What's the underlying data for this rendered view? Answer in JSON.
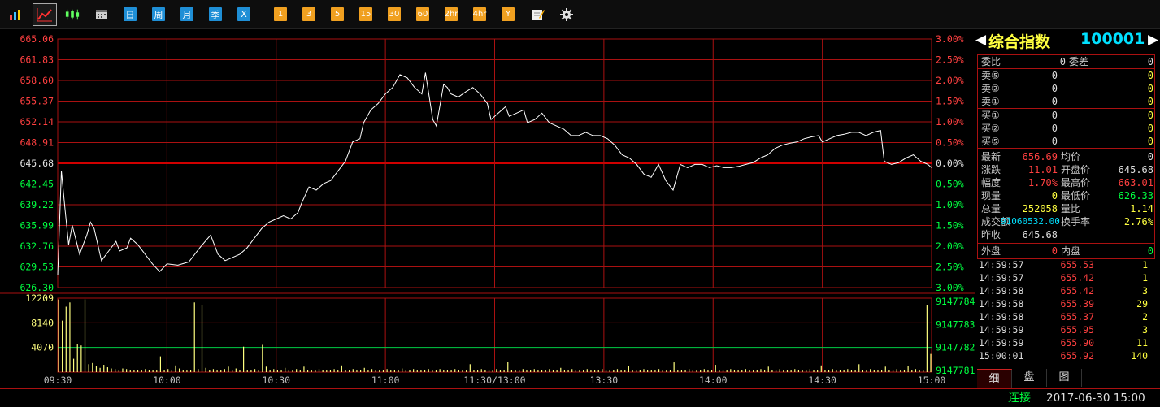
{
  "toolbar": {
    "icons": [
      "bar-chart-icon",
      "line-chart-icon",
      "candlestick-icon",
      "calendar-icon"
    ],
    "periods": [
      "日",
      "周",
      "月",
      "季",
      "X"
    ],
    "minutes": [
      "1",
      "3",
      "5",
      "15",
      "30",
      "60",
      "2hr",
      "4hr",
      "Y"
    ],
    "tools": [
      "edit-icon",
      "gear-icon"
    ]
  },
  "colors": {
    "up": "#ff4040",
    "down": "#00ff40",
    "grid": "#aa1111",
    "price_line": "#ffffff",
    "avg_line": "#ffff00",
    "volume": "#ffff80",
    "zero_line": "#c00000",
    "vol_ref": "#00cc44"
  },
  "chart_data": [
    {
      "type": "line",
      "title": "",
      "y_left_ticks": [
        "665.06",
        "661.83",
        "658.60",
        "655.37",
        "652.14",
        "648.91",
        "645.68",
        "642.45",
        "639.22",
        "635.99",
        "632.76",
        "629.53",
        "626.30"
      ],
      "y_right_ticks": [
        "3.00%",
        "2.50%",
        "2.00%",
        "1.50%",
        "1.00%",
        "0.50%",
        "0.00%",
        "0.50%",
        "1.00%",
        "1.50%",
        "2.00%",
        "2.50%",
        "3.00%"
      ],
      "ylim": [
        626.3,
        665.06
      ],
      "reference": 645.68,
      "x_ticks": [
        "09:30",
        "10:00",
        "10:30",
        "11:00",
        "11:30/13:00",
        "13:30",
        "14:00",
        "14:30",
        "15:00"
      ],
      "x_range": [
        0,
        240
      ],
      "series": [
        {
          "points": [
            [
              0,
              628.2
            ],
            [
              1,
              644.5
            ],
            [
              2,
              638.5
            ],
            [
              3,
              633.0
            ],
            [
              4,
              636.0
            ],
            [
              6,
              631.5
            ],
            [
              8,
              634.5
            ],
            [
              9,
              636.5
            ],
            [
              10,
              635.5
            ],
            [
              12,
              630.5
            ],
            [
              14,
              632.0
            ],
            [
              16,
              633.5
            ],
            [
              17,
              632.0
            ],
            [
              19,
              632.5
            ],
            [
              20,
              634.0
            ],
            [
              22,
              633.0
            ],
            [
              24,
              631.5
            ],
            [
              26,
              630.0
            ],
            [
              28,
              628.8
            ],
            [
              30,
              630.0
            ],
            [
              33,
              629.8
            ],
            [
              36,
              630.3
            ],
            [
              39,
              632.5
            ],
            [
              42,
              634.5
            ],
            [
              44,
              631.5
            ],
            [
              46,
              630.5
            ],
            [
              48,
              631.0
            ],
            [
              50,
              631.5
            ],
            [
              52,
              632.5
            ],
            [
              54,
              634.0
            ],
            [
              56,
              635.5
            ],
            [
              58,
              636.5
            ],
            [
              60,
              637.0
            ],
            [
              62,
              637.5
            ],
            [
              64,
              637.0
            ],
            [
              66,
              638.0
            ],
            [
              67,
              639.5
            ],
            [
              69,
              642.0
            ],
            [
              71,
              641.5
            ],
            [
              73,
              642.5
            ],
            [
              75,
              643.0
            ],
            [
              77,
              644.5
            ],
            [
              79,
              646.0
            ],
            [
              81,
              649.0
            ],
            [
              83,
              649.5
            ],
            [
              84,
              652.0
            ],
            [
              86,
              654.0
            ],
            [
              88,
              655.0
            ],
            [
              90,
              656.5
            ],
            [
              92,
              657.5
            ],
            [
              94,
              659.5
            ],
            [
              96,
              659.0
            ],
            [
              98,
              657.5
            ],
            [
              100,
              656.5
            ],
            [
              101,
              659.8
            ],
            [
              103,
              652.5
            ],
            [
              104,
              651.5
            ],
            [
              106,
              658.0
            ],
            [
              107,
              657.5
            ],
            [
              108,
              656.5
            ],
            [
              110,
              656.0
            ],
            [
              112,
              656.8
            ],
            [
              114,
              657.5
            ],
            [
              116,
              656.5
            ],
            [
              118,
              655.0
            ],
            [
              119,
              652.5
            ],
            [
              121,
              653.5
            ],
            [
              123,
              654.5
            ],
            [
              124,
              653.0
            ],
            [
              126,
              653.5
            ],
            [
              128,
              654.0
            ],
            [
              129,
              652.0
            ],
            [
              131,
              652.5
            ],
            [
              133,
              653.5
            ],
            [
              135,
              652.0
            ],
            [
              137,
              651.5
            ],
            [
              139,
              651.0
            ],
            [
              141,
              650.0
            ],
            [
              143,
              650.0
            ],
            [
              145,
              650.5
            ],
            [
              147,
              650.0
            ],
            [
              149,
              650.0
            ],
            [
              151,
              649.5
            ],
            [
              153,
              648.5
            ],
            [
              155,
              647.0
            ],
            [
              157,
              646.5
            ],
            [
              159,
              645.5
            ],
            [
              161,
              644.0
            ],
            [
              163,
              643.5
            ],
            [
              165,
              645.5
            ],
            [
              167,
              643.0
            ],
            [
              169,
              641.5
            ],
            [
              171,
              645.5
            ],
            [
              173,
              645.0
            ],
            [
              175,
              645.5
            ],
            [
              177,
              645.5
            ],
            [
              179,
              645.0
            ],
            [
              181,
              645.3
            ],
            [
              183,
              645.0
            ],
            [
              185,
              645.0
            ],
            [
              187,
              645.2
            ],
            [
              189,
              645.5
            ],
            [
              191,
              645.8
            ],
            [
              193,
              646.5
            ],
            [
              195,
              647.0
            ],
            [
              197,
              648.0
            ],
            [
              199,
              648.5
            ],
            [
              201,
              648.8
            ],
            [
              203,
              649.0
            ],
            [
              205,
              649.5
            ],
            [
              207,
              649.8
            ],
            [
              209,
              650.0
            ],
            [
              210,
              649.0
            ],
            [
              212,
              649.5
            ],
            [
              214,
              650.0
            ],
            [
              216,
              650.2
            ],
            [
              218,
              650.5
            ],
            [
              220,
              650.5
            ],
            [
              222,
              650.0
            ],
            [
              224,
              650.5
            ],
            [
              226,
              650.8
            ],
            [
              227,
              646.0
            ],
            [
              229,
              645.5
            ],
            [
              231,
              645.8
            ],
            [
              233,
              646.5
            ],
            [
              235,
              647.0
            ],
            [
              237,
              646.0
            ],
            [
              239,
              645.5
            ],
            [
              240,
              645.0
            ]
          ]
        },
        {
          "points": [
            [
              0,
              633.5
            ],
            [
              240,
              645.0
            ]
          ]
        }
      ]
    },
    {
      "type": "bar",
      "title": "",
      "y_left_ticks": [
        "12209",
        "8140",
        "4070"
      ],
      "y_right_ticks": [
        "9147784",
        "9147783",
        "9147782",
        "9147781"
      ],
      "ylim": [
        0,
        12209
      ],
      "reference": 4070,
      "values": [
        12000,
        8500,
        10800,
        11500,
        2200,
        4600,
        4400,
        12000,
        1300,
        1500,
        1000,
        700,
        1200,
        800,
        600,
        500,
        400,
        600,
        500,
        300,
        400,
        300,
        400,
        500,
        300,
        400,
        300,
        2600,
        300,
        500,
        300,
        1100,
        600,
        400,
        300,
        400,
        11500,
        500,
        11000,
        700,
        400,
        500,
        300,
        400,
        500,
        900,
        400,
        600,
        300,
        4200,
        400,
        300,
        500,
        300,
        4500,
        900,
        300,
        500,
        400,
        300,
        700,
        300,
        400,
        500,
        300,
        900,
        300,
        400,
        300,
        500,
        300,
        400,
        300,
        500,
        300,
        1100,
        400,
        300,
        500,
        300,
        400,
        700,
        300,
        500,
        300,
        400,
        300,
        500,
        300,
        400,
        300,
        600,
        300,
        400,
        500,
        300,
        400,
        300,
        500,
        400,
        300,
        500,
        300,
        400,
        300,
        500,
        300,
        400,
        300,
        1300,
        300,
        400,
        500,
        300,
        400,
        300,
        500,
        300,
        400,
        1700,
        300,
        400,
        300,
        500,
        300,
        400,
        500,
        300,
        400,
        300,
        500,
        300,
        400,
        700,
        300,
        400,
        500,
        300,
        400,
        300,
        500,
        300,
        400,
        300,
        500,
        300,
        400,
        300,
        500,
        300,
        400,
        1000,
        300,
        400,
        300,
        500,
        300,
        400,
        300,
        500,
        300,
        400,
        300,
        1600,
        300,
        400,
        300,
        500,
        300,
        400,
        300,
        500,
        300,
        400,
        1200,
        300,
        400,
        300,
        500,
        300,
        400,
        300,
        500,
        300,
        400,
        300,
        500,
        300,
        900,
        300,
        400,
        500,
        300,
        400,
        300,
        500,
        300,
        400,
        300,
        500,
        300,
        400,
        1100,
        300,
        400,
        500,
        300,
        400,
        300,
        500,
        300,
        400,
        1300,
        300,
        400,
        500,
        300,
        400,
        300,
        900,
        300,
        400,
        500,
        300,
        400,
        1000,
        300,
        500,
        300,
        400,
        11000,
        3000
      ]
    }
  ],
  "quote": {
    "name": "综合指数",
    "code": "100001",
    "weibi_label": "委比",
    "weibi": "0",
    "weicha_label": "委差",
    "weicha": "0",
    "sells": [
      {
        "label": "卖⑤",
        "price": "0",
        "vol": "0"
      },
      {
        "label": "卖②",
        "price": "0",
        "vol": "0"
      },
      {
        "label": "卖①",
        "price": "0",
        "vol": "0"
      }
    ],
    "buys": [
      {
        "label": "买①",
        "price": "0",
        "vol": "0"
      },
      {
        "label": "买②",
        "price": "0",
        "vol": "0"
      },
      {
        "label": "买⑤",
        "price": "0",
        "vol": "0"
      }
    ],
    "stats": {
      "latest_label": "最新",
      "latest": "656.69",
      "avg_label": "均价",
      "avg": "0",
      "change_label": "涨跌",
      "change": "11.01",
      "open_label": "开盘价",
      "open": "645.68",
      "amp_label": "幅度",
      "amp": "1.70%",
      "high_label": "最高价",
      "high": "663.01",
      "now_label": "现量",
      "now": "0",
      "low_label": "最低价",
      "low": "626.33",
      "total_label": "总量",
      "total": "252058",
      "ratio_label": "量比",
      "ratio": "1.14",
      "amount_label": "成交额",
      "amount": "91060532.00",
      "turnover_label": "换手率",
      "turnover": "2.76%",
      "prev_label": "昨收",
      "prev": "645.68"
    },
    "outer_label": "外盘",
    "outer": "0",
    "inner_label": "内盘",
    "inner": "0",
    "trades": [
      {
        "time": "14:59:57",
        "price": "655.53",
        "vol": "1"
      },
      {
        "time": "14:59:57",
        "price": "655.42",
        "vol": "1"
      },
      {
        "time": "14:59:58",
        "price": "655.42",
        "vol": "3"
      },
      {
        "time": "14:59:58",
        "price": "655.39",
        "vol": "29"
      },
      {
        "time": "14:59:58",
        "price": "655.37",
        "vol": "2"
      },
      {
        "time": "14:59:59",
        "price": "655.95",
        "vol": "3"
      },
      {
        "time": "14:59:59",
        "price": "655.90",
        "vol": "11"
      },
      {
        "time": "15:00:01",
        "price": "655.92",
        "vol": "140"
      }
    ],
    "tabs": [
      "细",
      "盘",
      "图"
    ]
  },
  "status": {
    "connection": "连接",
    "datetime": "2017-06-30 15:00"
  }
}
